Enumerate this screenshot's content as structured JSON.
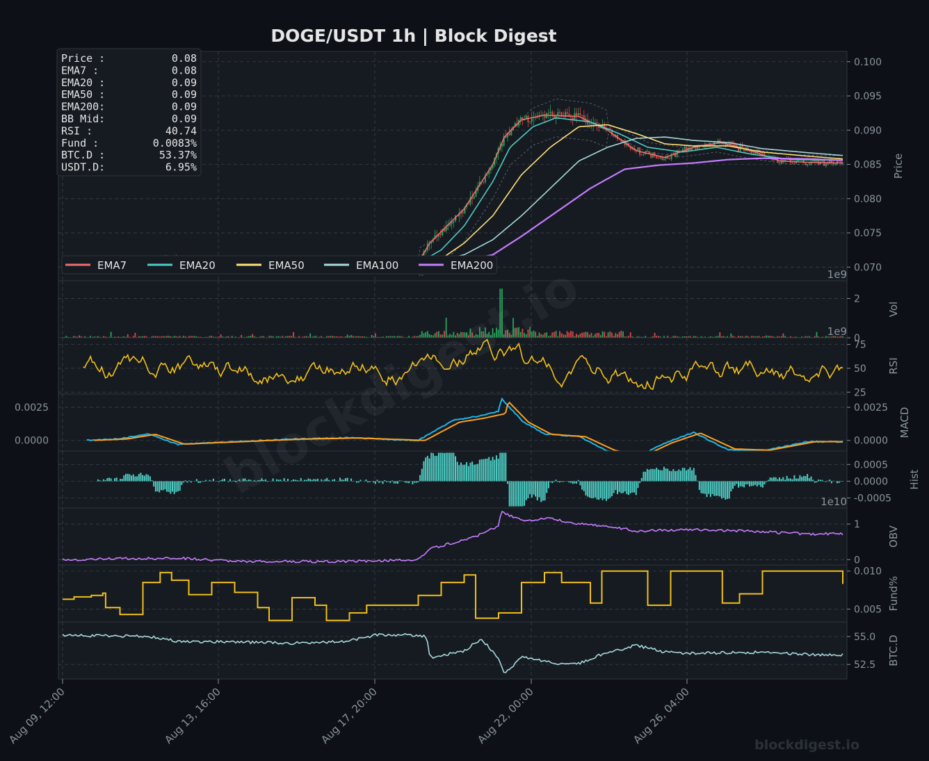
{
  "title": "DOGE/USDT  1h  |  Block Digest",
  "watermark": "blockdigest.io",
  "footer": "blockdigest.io",
  "colors": {
    "background": "#0d1117",
    "panel": "#161b22",
    "grid": "#3a4048",
    "text": "#e6e6e6",
    "muted": "#8b949e",
    "up": "#26a65b",
    "down": "#e04545",
    "ema7": "#ef6f6f",
    "ema20": "#4ecdc4",
    "ema50": "#ffe27a",
    "ema100": "#a8dadc",
    "ema200": "#c77dff",
    "rsi": "#f2c01a",
    "macd": "#1fb6e8",
    "signal": "#ff9f1a",
    "hist": "#4ecdc4",
    "obv": "#c77dff",
    "fund": "#f2c01a",
    "btcd": "#a8dadc"
  },
  "info_box": [
    {
      "label": "Price :",
      "value": "0.08"
    },
    {
      "label": "EMA7  :",
      "value": "0.08"
    },
    {
      "label": "EMA20 :",
      "value": "0.09"
    },
    {
      "label": "EMA50 :",
      "value": "0.09"
    },
    {
      "label": "EMA200:",
      "value": "0.09"
    },
    {
      "label": "BB Mid:",
      "value": "0.09"
    },
    {
      "label": "RSI   :",
      "value": "40.74"
    },
    {
      "label": "Fund  :",
      "value": "0.0083%"
    },
    {
      "label": "BTC.D :",
      "value": "53.37%"
    },
    {
      "label": "USDT.D:",
      "value": "6.95%"
    }
  ],
  "legend": [
    "EMA7",
    "EMA20",
    "EMA50",
    "EMA100",
    "EMA200"
  ],
  "chart_data": {
    "type": "line",
    "x_ticks": [
      "Aug 09, 12:00",
      "Aug 13, 16:00",
      "Aug 17, 20:00",
      "Aug 22, 00:00",
      "Aug 26, 04:00"
    ],
    "panels": [
      {
        "id": "price",
        "ylabel": "Price",
        "ylim": [
          0.068,
          0.1015
        ],
        "ticks": [
          "0.070",
          "0.075",
          "0.080",
          "0.085",
          "0.090",
          "0.095",
          "0.100"
        ],
        "tick_values": [
          0.07,
          0.075,
          0.08,
          0.085,
          0.09,
          0.095,
          0.1
        ],
        "offset": "1e9",
        "series": [
          {
            "name": "EMA7",
            "key": "ema7",
            "points": [
              [
                0,
                0.0705
              ],
              [
                0.1,
                0.071
              ],
              [
                0.2,
                0.0712
              ],
              [
                0.3,
                0.0706
              ],
              [
                0.4,
                0.0702
              ],
              [
                0.5,
                0.0702
              ],
              [
                0.62,
                0.0707
              ],
              [
                0.64,
                0.0735
              ],
              [
                0.7,
                0.0785
              ],
              [
                0.75,
                0.085
              ],
              [
                0.77,
                0.089
              ],
              [
                0.8,
                0.0915
              ],
              [
                0.84,
                0.0922
              ],
              [
                0.9,
                0.092
              ],
              [
                0.95,
                0.09
              ],
              [
                1.0,
                0.087
              ],
              [
                1.05,
                0.086
              ],
              [
                1.1,
                0.0875
              ],
              [
                1.15,
                0.0882
              ],
              [
                1.2,
                0.087
              ],
              [
                1.25,
                0.0855
              ],
              [
                1.3,
                0.0853
              ],
              [
                1.36,
                0.0852
              ]
            ]
          },
          {
            "name": "EMA20",
            "key": "ema20",
            "points": [
              [
                0,
                0.0705
              ],
              [
                0.2,
                0.071
              ],
              [
                0.4,
                0.0703
              ],
              [
                0.62,
                0.0706
              ],
              [
                0.66,
                0.0725
              ],
              [
                0.7,
                0.076
              ],
              [
                0.75,
                0.0825
              ],
              [
                0.78,
                0.0875
              ],
              [
                0.82,
                0.0905
              ],
              [
                0.86,
                0.0918
              ],
              [
                0.92,
                0.0912
              ],
              [
                0.97,
                0.0895
              ],
              [
                1.02,
                0.0875
              ],
              [
                1.08,
                0.0868
              ],
              [
                1.14,
                0.0875
              ],
              [
                1.2,
                0.0865
              ],
              [
                1.27,
                0.0857
              ],
              [
                1.36,
                0.0856
              ]
            ]
          },
          {
            "name": "EMA50",
            "key": "ema50",
            "points": [
              [
                0,
                0.0704
              ],
              [
                0.3,
                0.0706
              ],
              [
                0.62,
                0.0705
              ],
              [
                0.66,
                0.0712
              ],
              [
                0.7,
                0.0735
              ],
              [
                0.75,
                0.0775
              ],
              [
                0.8,
                0.0835
              ],
              [
                0.85,
                0.0875
              ],
              [
                0.9,
                0.0905
              ],
              [
                0.95,
                0.0908
              ],
              [
                1.0,
                0.0895
              ],
              [
                1.05,
                0.088
              ],
              [
                1.1,
                0.0877
              ],
              [
                1.16,
                0.0877
              ],
              [
                1.22,
                0.0868
              ],
              [
                1.3,
                0.0862
              ],
              [
                1.36,
                0.0858
              ]
            ]
          },
          {
            "name": "EMA100",
            "key": "ema100",
            "points": [
              [
                0,
                0.0703
              ],
              [
                0.4,
                0.0704
              ],
              [
                0.62,
                0.0704
              ],
              [
                0.7,
                0.0718
              ],
              [
                0.75,
                0.074
              ],
              [
                0.8,
                0.0775
              ],
              [
                0.85,
                0.0815
              ],
              [
                0.9,
                0.0855
              ],
              [
                0.95,
                0.0875
              ],
              [
                1.0,
                0.0888
              ],
              [
                1.05,
                0.089
              ],
              [
                1.1,
                0.0885
              ],
              [
                1.16,
                0.0882
              ],
              [
                1.22,
                0.0873
              ],
              [
                1.3,
                0.0867
              ],
              [
                1.36,
                0.0863
              ]
            ]
          },
          {
            "name": "EMA200",
            "key": "ema200",
            "points": [
              [
                0,
                0.0702
              ],
              [
                0.5,
                0.0703
              ],
              [
                0.68,
                0.0706
              ],
              [
                0.75,
                0.0718
              ],
              [
                0.8,
                0.0745
              ],
              [
                0.86,
                0.078
              ],
              [
                0.92,
                0.0815
              ],
              [
                0.98,
                0.0843
              ],
              [
                1.04,
                0.0849
              ],
              [
                1.1,
                0.0852
              ],
              [
                1.16,
                0.0857
              ],
              [
                1.22,
                0.0859
              ],
              [
                1.3,
                0.0858
              ],
              [
                1.36,
                0.0856
              ]
            ]
          }
        ]
      },
      {
        "id": "vol",
        "ylabel": "Vol",
        "ylim": [
          0,
          2.9
        ],
        "ticks": [
          "0",
          "2"
        ],
        "tick_values": [
          0,
          2
        ],
        "offset": "1e9"
      },
      {
        "id": "rsi",
        "ylabel": "RSI",
        "ylim": [
          23,
          82
        ],
        "ticks": [
          "25",
          "50",
          "75"
        ],
        "tick_values": [
          25,
          50,
          75
        ]
      },
      {
        "id": "macd",
        "ylabel": "MACD",
        "ylim": [
          -0.0008,
          0.0035
        ],
        "ticks": [
          "0.0000",
          "0.0025"
        ],
        "tick_values": [
          0,
          0.0025
        ]
      },
      {
        "id": "hist",
        "ylabel": "Hist",
        "ylim": [
          -0.0008,
          0.0009
        ],
        "ticks": [
          "-0.0005",
          "0.0000",
          "0.0005"
        ],
        "tick_values": [
          -0.0005,
          0,
          0.0005
        ],
        "offset": "1e10"
      },
      {
        "id": "obv",
        "ylabel": "OBV",
        "ylim": [
          -0.15,
          1.45
        ],
        "ticks": [
          "0",
          "1"
        ],
        "tick_values": [
          0,
          1
        ]
      },
      {
        "id": "fund",
        "ylabel": "Fund%",
        "ylim": [
          0.0033,
          0.0108
        ],
        "ticks": [
          "0.005",
          "0.010"
        ],
        "tick_values": [
          0.005,
          0.01
        ]
      },
      {
        "id": "btcd",
        "ylabel": "BTC.D",
        "ylim": [
          51.2,
          56.3
        ],
        "ticks": [
          "52.5",
          "55.0"
        ],
        "tick_values": [
          52.5,
          55.0
        ]
      }
    ],
    "left_ticks_macd": [
      "0.0025",
      "0.0000"
    ]
  }
}
